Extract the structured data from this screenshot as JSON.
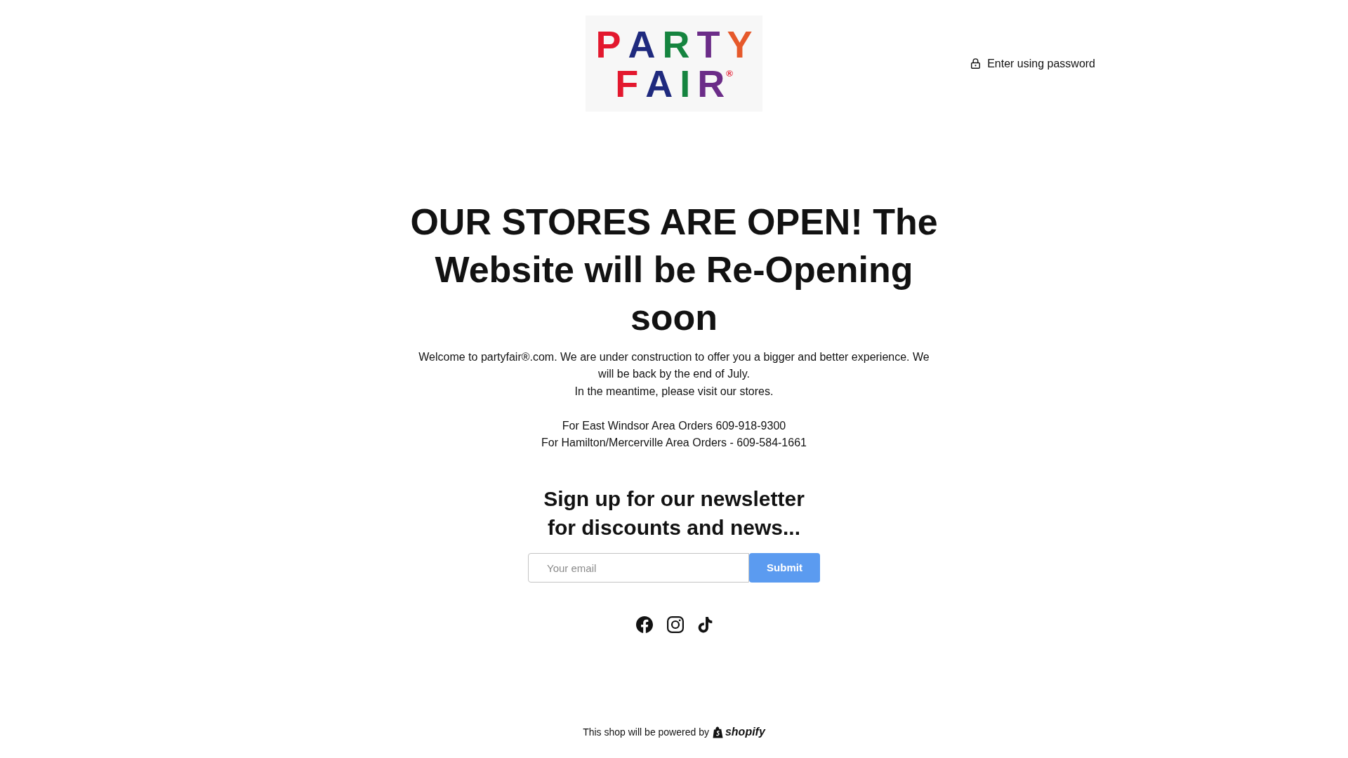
{
  "header": {
    "logo": {
      "lines": [
        {
          "letters": [
            {
              "text": "P",
              "color": "#e3182e"
            },
            {
              "text": "A",
              "color": "#1f2a7e"
            },
            {
              "text": "R",
              "color": "#15843f"
            },
            {
              "text": "T",
              "color": "#6b2c88"
            },
            {
              "text": "Y",
              "color": "#e6592b"
            }
          ]
        },
        {
          "letters": [
            {
              "text": "F",
              "color": "#e3182e"
            },
            {
              "text": "A",
              "color": "#1f2a7e"
            },
            {
              "text": "I",
              "color": "#15843f"
            },
            {
              "text": "R",
              "color": "#6b2c88"
            }
          ]
        }
      ],
      "registered_mark": "®"
    },
    "password_link": "Enter using password"
  },
  "headline": "OUR STORES ARE OPEN! The Website will be Re-Opening soon",
  "description": {
    "paragraphs": [
      "Welcome to partyfair®.com. We are under construction to offer you a bigger and better experience. We will be back by the end of July.",
      "In the meantime, please visit our stores."
    ],
    "store_lines": [
      "For East Windsor Area Orders 609-918-9300",
      "For Hamilton/Mercerville Area Orders - 609-584-1661"
    ]
  },
  "newsletter": {
    "heading": "Sign up for our newsletter for discounts and news...",
    "email_field": {
      "placeholder": "Your email"
    },
    "submit_button": "Submit"
  },
  "social_links": [
    {
      "kind": "facebook"
    },
    {
      "kind": "instagram"
    },
    {
      "kind": "tiktok"
    }
  ],
  "footer": {
    "text": "This shop will be powered by",
    "brand": "shopify"
  }
}
